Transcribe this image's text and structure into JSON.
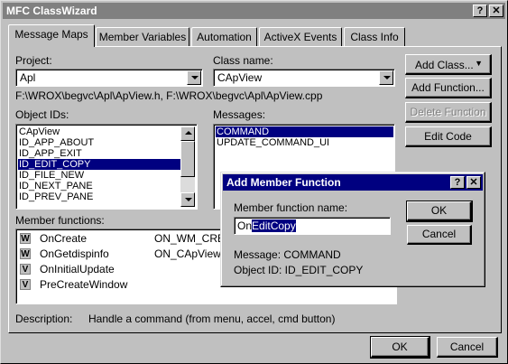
{
  "window": {
    "title": "MFC ClassWizard",
    "help_btn": "?",
    "close_btn": "✕"
  },
  "tabs": [
    {
      "label": "Message Maps",
      "active": true
    },
    {
      "label": "Member Variables"
    },
    {
      "label": "Automation"
    },
    {
      "label": "ActiveX Events"
    },
    {
      "label": "Class Info"
    }
  ],
  "project": {
    "label": "Project:",
    "value": "Apl"
  },
  "class_name": {
    "label": "Class name:",
    "value": "CApView"
  },
  "file_path": "F:\\WROX\\begvc\\Apl\\ApView.h, F:\\WROX\\begvc\\Apl\\ApView.cpp",
  "object_ids": {
    "label": "Object IDs:",
    "items": [
      "CApView",
      "ID_APP_ABOUT",
      "ID_APP_EXIT",
      "ID_EDIT_COPY",
      "ID_FILE_NEW",
      "ID_NEXT_PANE",
      "ID_PREV_PANE"
    ],
    "selected_index": 3
  },
  "messages": {
    "label": "Messages:",
    "items": [
      "COMMAND",
      "UPDATE_COMMAND_UI"
    ],
    "selected_index": 0
  },
  "member_functions": {
    "label": "Member functions:",
    "items": [
      {
        "badge": "W",
        "name": "OnCreate",
        "handler": "ON_WM_CREA"
      },
      {
        "badge": "W",
        "name": "OnGetdispinfo",
        "handler": "ON_CApView:L"
      },
      {
        "badge": "V",
        "name": "OnInitialUpdate",
        "handler": ""
      },
      {
        "badge": "V",
        "name": "PreCreateWindow",
        "handler": ""
      }
    ]
  },
  "description": {
    "label": "Description:",
    "text": "Handle a command (from menu, accel, cmd button)"
  },
  "side_buttons": {
    "add_class": "Add Class...",
    "add_class_arrow": "▼",
    "add_function": "Add Function...",
    "delete_function": "Delete Function",
    "edit_code": "Edit Code"
  },
  "footer": {
    "ok": "OK",
    "cancel": "Cancel"
  },
  "dialog": {
    "title": "Add Member Function",
    "help_btn": "?",
    "close_btn": "✕",
    "name_label": "Member function name:",
    "name_prefix": "On",
    "name_selected": "EditCopy",
    "message_line": "Message: COMMAND",
    "object_line": "Object ID: ID_EDIT_COPY",
    "ok": "OK",
    "cancel": "Cancel"
  },
  "colors": {
    "active_title": "#000080",
    "inactive_title": "#808080",
    "selection": "#000080",
    "face": "#c0c0c0"
  }
}
